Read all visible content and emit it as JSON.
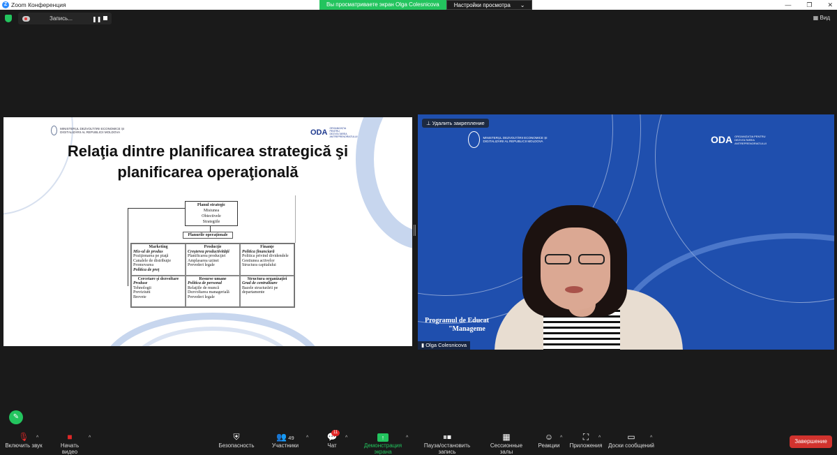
{
  "window": {
    "title": "Zoom Конференция",
    "logo_letter": "Z",
    "controls": [
      "—",
      "❐",
      "✕"
    ]
  },
  "share_banner": {
    "viewing": "Вы просматриваете экран Olga Colesnicova",
    "settings": "Настройки просмотра",
    "caret": "⌄"
  },
  "recording": {
    "label": "Запись...",
    "pause": "❚❚"
  },
  "view": {
    "label": "Вид",
    "icon": "▦"
  },
  "slide": {
    "title_line1": "Relaţia dintre planificarea strategică şi",
    "title_line2": "planificarea operaţională",
    "ministry": "MINISTERUL DEZVOLTĂRII ECONOMICE ȘI DIGITALIZĂRII AL REPUBLICII MOLDOVA",
    "oda": "ODA",
    "oda_sub": "ORGANIZAȚIA PENTRU DEZVOLTAREA ANTREPRENORIATULUI",
    "diagram": {
      "strategic_title": "Planul strategic",
      "strategic_items": [
        "Misiunea",
        "Obiectivele",
        "Strategiile"
      ],
      "operational": "Planurile operaţionale",
      "cells": [
        {
          "head": "Marketing",
          "sub": "Mix-ul de produs",
          "items": [
            "Poziţionarea pe piaţă",
            "Canalele de distribuţie",
            "Promovarea"
          ],
          "extra": "Politica de preţ"
        },
        {
          "head": "Producţie",
          "sub": "Creşterea productivităţii",
          "items": [
            "Planificarea producţiei",
            "Amplasarea uzinei",
            "Prevederi legale"
          ],
          "extra": ""
        },
        {
          "head": "Finanţe",
          "sub": "Politica financiară",
          "items": [
            "Politica privind dividendele",
            "Gestiunea activelor",
            "Structura capitalului"
          ],
          "extra": ""
        },
        {
          "head": "Cercetare şi dezvoltare",
          "sub": "Produse",
          "items": [
            "Tehnologii",
            "Previziuni",
            "Brevete"
          ],
          "extra": ""
        },
        {
          "head": "Resurse umane",
          "sub": "Politica de personal",
          "items": [
            "Relaţiile de muncă",
            "Dezvoltarea managerială",
            "Prevederi legale"
          ],
          "extra": ""
        },
        {
          "head": "Structura organizaţiei",
          "sub": "Grad de centralizare",
          "items": [
            "Bazele structurării pe departamente"
          ],
          "extra": ""
        }
      ]
    }
  },
  "video": {
    "unpin_label": "Удалить закрепление",
    "ministry": "MINISTERUL DEZVOLTĂRII ECONOMICE ȘI DIGITALIZĂRII AL REPUBLICII MOLDOVA",
    "oda": "ODA",
    "oda_sub": "ORGANIZAȚIA PENTRU DEZVOLTAREA ANTREPRENORIATULUI",
    "program_line1": "Programul de Educat",
    "program_line2": "\"Manageme",
    "participant_name": "Olga Colesnicova"
  },
  "toolbar": {
    "unmute": "Включить звук",
    "start_video": "Начать видео",
    "security": "Безопасность",
    "participants": "Участники",
    "participants_count": "49",
    "chat": "Чат",
    "chat_badge": "11",
    "share_screen": "Демонстрация экрана",
    "pause_record": "Пауза/остановить запись",
    "breakout": "Сессионные залы",
    "reactions": "Реакции",
    "apps": "Приложения",
    "whiteboards": "Доски сообщений",
    "end": "Завершение",
    "caret": "^"
  },
  "icons": {
    "mic": "mic-muted-icon",
    "video": "video-off-icon",
    "security": "shield-icon",
    "participants": "people-icon",
    "chat": "chat-icon",
    "share": "share-up-arrow-icon",
    "pause": "pause-stop-icon",
    "breakout": "grid-icon",
    "reactions": "emoji-icon",
    "apps": "apps-icon",
    "whiteboard": "whiteboard-icon",
    "pencil": "pencil-icon"
  },
  "colors": {
    "accent_green": "#23c45e",
    "end_red": "#d1332e",
    "video_blue": "#1f4fae",
    "badge_red": "#e02828"
  }
}
